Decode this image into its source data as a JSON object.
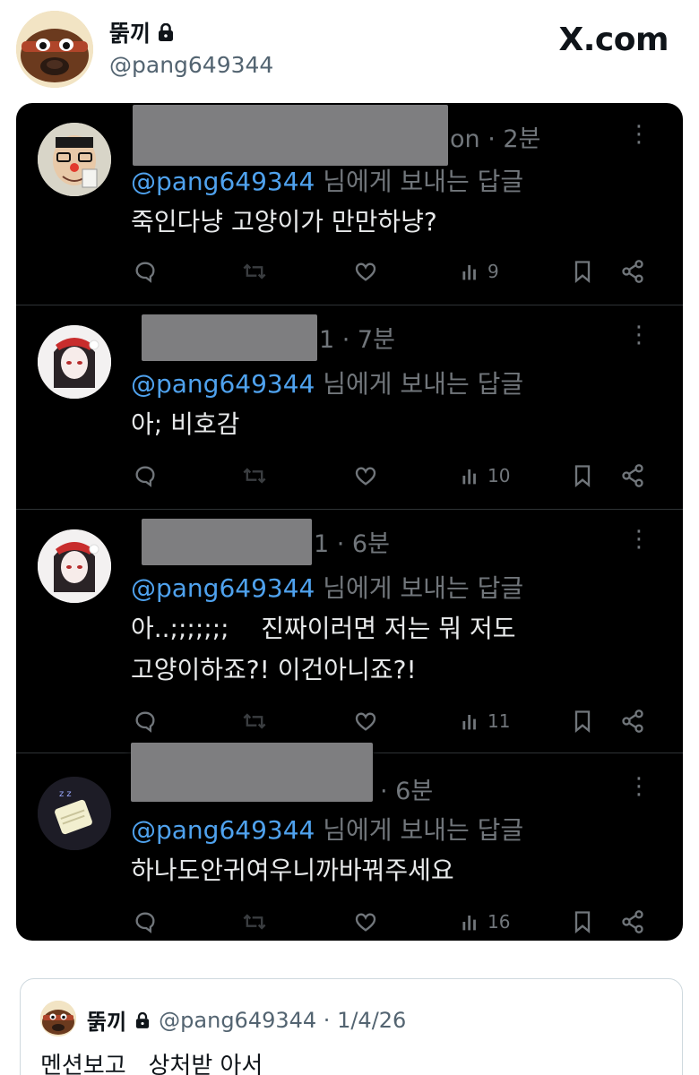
{
  "header": {
    "display_name": "뚥끼",
    "handle": "@pang649344",
    "site": "X.com"
  },
  "replies": [
    {
      "meta_suffix": "on · 2분",
      "replying_mention": "@pang649344",
      "replying_suffix": " 님에게 보내는 답글",
      "text": "죽인다냥 고양이가 만만하냥?",
      "views": "9"
    },
    {
      "meta_suffix": "1 · 7분",
      "replying_mention": "@pang649344",
      "replying_suffix": " 님에게 보내는 답글",
      "text": "아; 비호감",
      "views": "10"
    },
    {
      "meta_suffix": "1 · 6분",
      "replying_mention": "@pang649344",
      "replying_suffix": " 님에게 보내는 답글",
      "text_line1": "아..;;;;;;;    진짜이러면 저는 뭐 저도",
      "text_line2": "고양이하죠?! 이건아니죠?!",
      "views": "11"
    },
    {
      "meta_suffix": "· 6분",
      "replying_mention": "@pang649344",
      "replying_suffix": " 님에게 보내는 답글",
      "text": "하나도안귀여우니까바꿔주세요",
      "views": "16"
    }
  ],
  "more_glyph": "⋮",
  "quote": {
    "display_name": "뚥끼",
    "handle_date": "@pang649344 · 1/4/26",
    "text": "멘션보고   상처받 아서"
  },
  "icons": [
    "lock-icon",
    "reply-icon",
    "retweet-icon",
    "like-icon",
    "views-icon",
    "bookmark-icon",
    "share-icon",
    "more-icon"
  ],
  "colors": {
    "panel_bg": "#000000",
    "mention": "#4fa2ee",
    "muted": "#71767b",
    "redaction": "#7e7e80"
  }
}
